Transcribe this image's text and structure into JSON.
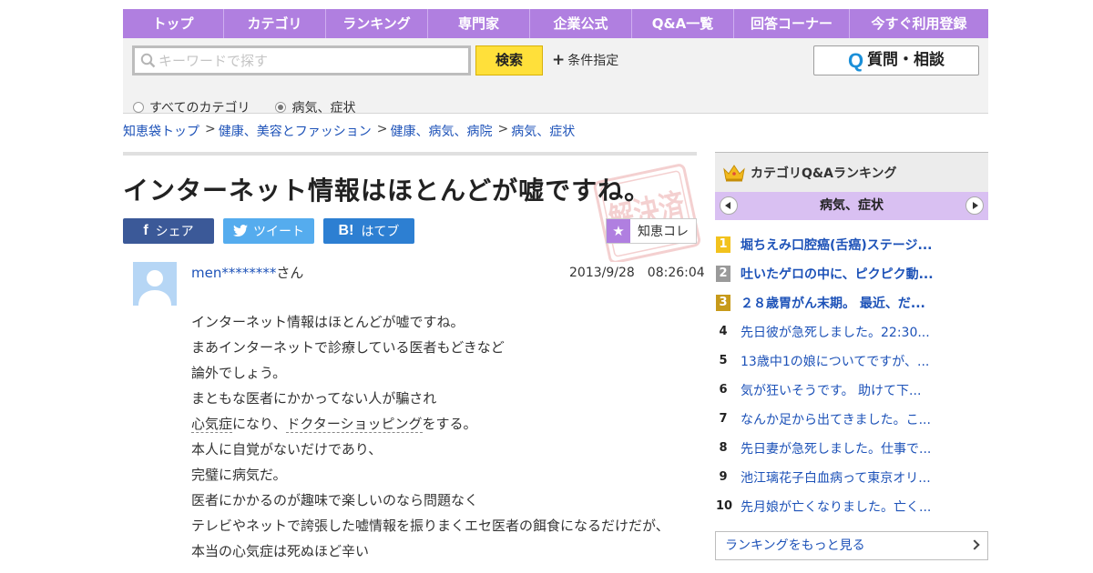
{
  "nav": [
    "トップ",
    "カテゴリ",
    "ランキング",
    "専門家",
    "企業公式",
    "Q&A一覧",
    "回答コーナー",
    "今すぐ利用登録"
  ],
  "search": {
    "placeholder": "キーワードで探す",
    "button": "検索",
    "condition": "条件指定",
    "ask_button": "質問・相談",
    "ask_icon": "Q",
    "radio_all": "すべてのカテゴリ",
    "radio_current": "病気、症状"
  },
  "breadcrumb": [
    "知恵袋トップ",
    "健康、美容とファッション",
    "健康、病気、病院",
    "病気、症状"
  ],
  "breadcrumb_sep": ">",
  "question": {
    "title": "インターネット情報はほとんどが嘘ですね。",
    "stamp_text": "解決済",
    "share": {
      "facebook": "シェア",
      "twitter": "ツイート",
      "hatena": "はてブ",
      "hatena_icon": "B!"
    },
    "chie_label": "知恵コレ",
    "user_name": "men********",
    "user_suffix": "さん",
    "date": "2013/9/28　08:26:04",
    "body_lines": [
      "インターネット情報はほとんどが嘘ですね。",
      "まあインターネットで診療している医者もどきなど",
      "論外でしょう。",
      "まともな医者にかかってない人が騙され",
      "",
      "本人に自覚がないだけであり、",
      "完璧に病気だ。",
      "医者にかかるのが趣味で楽しいのなら問題なく",
      "テレビやネットで誇張した嘘情報を振りまくエセ医者の餌食になるだけだが、",
      "本当の心気症は死ぬほど辛い"
    ],
    "line5": {
      "kw1": "心気症",
      "mid": "になり、",
      "kw2": "ドクターショッピング",
      "end": "をする。"
    }
  },
  "sidebar": {
    "title": "カテゴリQ&Aランキング",
    "category": "病気、症状",
    "ranking": [
      {
        "rank": "1",
        "text": "堀ちえみ口腔癌(舌癌)ステージ..."
      },
      {
        "rank": "2",
        "text": "吐いたゲロの中に、ピクピク動..."
      },
      {
        "rank": "3",
        "text": "２８歳胃がん末期。 最近、だ..."
      },
      {
        "rank": "4",
        "text": "先日彼が急死しました。22:30..."
      },
      {
        "rank": "5",
        "text": "13歳中1の娘についてですが、..."
      },
      {
        "rank": "6",
        "text": "気が狂いそうです。 助けて下..."
      },
      {
        "rank": "7",
        "text": "なんか足から出てきました。こ..."
      },
      {
        "rank": "8",
        "text": "先日妻が急死しました。仕事で..."
      },
      {
        "rank": "9",
        "text": "池江璃花子白血病って東京オリ..."
      },
      {
        "rank": "10",
        "text": "先月娘が亡くなりました。亡く..."
      }
    ],
    "more": "ランキングをもっと見る"
  },
  "colors": {
    "nav": "#b07fe0",
    "link": "#1d52b8",
    "search_button": "#ffe03a",
    "facebook": "#3b5998",
    "twitter": "#55acee",
    "hatena": "#2d7fd2"
  }
}
